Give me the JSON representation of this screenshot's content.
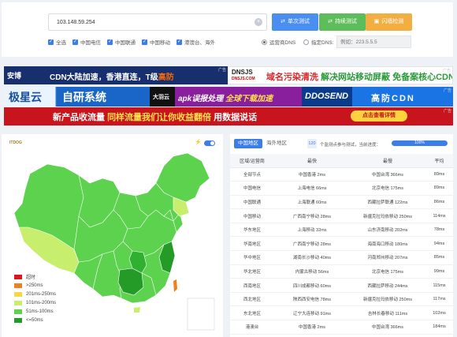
{
  "search": {
    "ip_value": "103.148.59.254",
    "buttons": {
      "single": "单次测试",
      "continuous": "持续测试",
      "wall": "闪墙检测"
    },
    "filters": [
      {
        "label": "全选",
        "checked": true
      },
      {
        "label": "中国电信",
        "checked": true
      },
      {
        "label": "中国联通",
        "checked": true
      },
      {
        "label": "中国移动",
        "checked": true
      },
      {
        "label": "港澳台、海外",
        "checked": true
      }
    ],
    "dns_mode": [
      {
        "label": "运营商DNS",
        "selected": true
      },
      {
        "label": "指定DNS:",
        "selected": false
      }
    ],
    "dns_placeholder": "例如：223.5.5.5"
  },
  "ads": {
    "label": "广告",
    "anquan": {
      "logo": "安博",
      "text_a": "CDN大陆加速，香港直连，T级",
      "text_b": "高防"
    },
    "dnsjs": {
      "logo": "DNSJS",
      "sub": "DNSJS.COM",
      "text_a": "域名污染清洗 ",
      "text_b": "解决网站移动屏蔽 免备案核心CDN"
    },
    "jixing": {
      "brand": "极星云",
      "sys": "自研系统"
    },
    "dayu": {
      "text": "大羽云"
    },
    "apk": {
      "text_a": "apk误报处理 ",
      "text_b": "全球下载加速"
    },
    "ddos": {
      "text": "DDOSEND"
    },
    "cdn": {
      "text": "高防CDN"
    },
    "red": {
      "text_a": "新产品收流量  ",
      "text_b": "同样流量我们让你收益翻倍",
      "text_c": "  用数据说话",
      "button": "点击查看详情"
    }
  },
  "map": {
    "logo": "ITDOG",
    "flash": "⚡",
    "legend": [
      {
        "label": "超时",
        "color": "#d9191c"
      },
      {
        "label": ">250ms",
        "color": "#f07f1e"
      },
      {
        "label": "201ms-250ms",
        "color": "#f7d84a"
      },
      {
        "label": "101ms-200ms",
        "color": "#c8ee6e"
      },
      {
        "label": "51ms-100ms",
        "color": "#5dd24f"
      },
      {
        "label": "<=50ms",
        "color": "#249a27"
      }
    ]
  },
  "results": {
    "tabs": [
      "中国地区",
      "海外地区"
    ],
    "count": "120",
    "progress_label": "个监测点参与测试，当前进度：",
    "progress_percent": 100,
    "progress_text": "100%",
    "headers": [
      "区域/运营商",
      "最快",
      "最慢",
      "平均"
    ],
    "rows": [
      [
        "全部节点",
        "中国香港 2ms",
        "中国台湾 366ms",
        "89ms"
      ],
      [
        "中国电信",
        "上海电信 66ms",
        "北京电信 175ms",
        "89ms"
      ],
      [
        "中国联通",
        "上海联通 60ms",
        "西藏拉萨联通 122ms",
        "86ms"
      ],
      [
        "中国移动",
        "广西南宁移动 28ms",
        "新疆克拉玛依移动 250ms",
        "114ms"
      ],
      [
        "华东地区",
        "上海移动 32ms",
        "山东济南移动 202ms",
        "78ms"
      ],
      [
        "华南地区",
        "广西南宁移动 28ms",
        "海南海口移动 180ms",
        "94ms"
      ],
      [
        "华中地区",
        "湖南长沙移动 40ms",
        "河南郑州移动 207ms",
        "85ms"
      ],
      [
        "华北地区",
        "内蒙古移动 56ms",
        "北京电信 175ms",
        "99ms"
      ],
      [
        "西南地区",
        "四川成都移动 60ms",
        "西藏拉萨移动 244ms",
        "115ms"
      ],
      [
        "西北地区",
        "陕西西安电信 78ms",
        "新疆克拉玛依移动 250ms",
        "117ms"
      ],
      [
        "东北地区",
        "辽宁大连移动 91ms",
        "吉林长春移动 111ms",
        "102ms"
      ],
      [
        "港澳台",
        "中国香港 2ms",
        "中国台湾 366ms",
        "184ms"
      ]
    ]
  }
}
